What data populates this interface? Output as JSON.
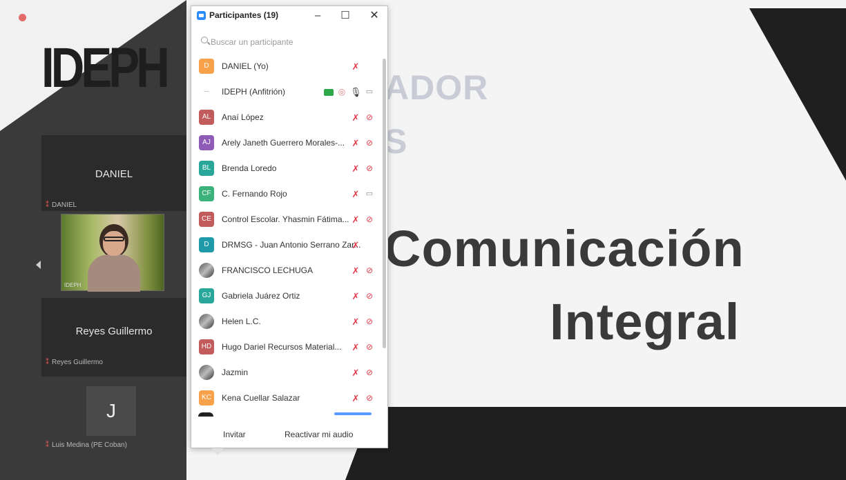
{
  "colors": {
    "accent": "#2d8cff",
    "muted_red": "#e5394a",
    "green_badge": "#2ea84a"
  },
  "slide": {
    "logo": "IDEPH",
    "faded_line_1": "ADOR",
    "faded_line_2": "S",
    "title_line_1": "Comunicación",
    "title_line_2": "Integral"
  },
  "tiles": {
    "daniel": {
      "name": "DANIEL",
      "sub": "DANIEL"
    },
    "video": {
      "label": "IDEPH"
    },
    "reyes": {
      "name": "Reyes Guillermo",
      "sub": "Reyes Guillermo"
    },
    "j": {
      "initial": "J",
      "sub": "Luis Medina (PE Coban)"
    }
  },
  "panel": {
    "title": "Participantes (19)",
    "search_placeholder": "Buscar un participante",
    "participants": [
      {
        "initials": "D",
        "color": "#f7a24b",
        "name": "DANIEL (Yo)",
        "mic": "muted",
        "cam": "none"
      },
      {
        "initials": "",
        "color": "#ffffff",
        "name": "IDEPH (Anfitrión)",
        "mic": "on",
        "cam": "on",
        "badge": "green",
        "host": true
      },
      {
        "initials": "AL",
        "color": "#c25b5b",
        "name": "Anaí López",
        "mic": "muted",
        "cam": "off"
      },
      {
        "initials": "AJ",
        "color": "#8e5bb7",
        "name": "Arely Janeth Guerrero Morales-...",
        "mic": "muted",
        "cam": "off"
      },
      {
        "initials": "BL",
        "color": "#2aa79b",
        "name": "Brenda Loredo",
        "mic": "muted",
        "cam": "off"
      },
      {
        "initials": "CF",
        "color": "#3ab27a",
        "name": "C. Fernando Rojo",
        "mic": "muted",
        "cam": "on"
      },
      {
        "initials": "CE",
        "color": "#c25b5b",
        "name": "Control Escolar. Yhasmin Fátima...",
        "mic": "muted",
        "cam": "off"
      },
      {
        "initials": "D",
        "color": "#1e9aa8",
        "name": "DRMSG - Juan Antonio Serrano Zar...",
        "mic": "muted",
        "cam": "none"
      },
      {
        "initials": "",
        "color": "#666666",
        "name": "FRANCISCO LECHUGA",
        "mic": "muted",
        "cam": "off",
        "photo": true
      },
      {
        "initials": "GJ",
        "color": "#2aa79b",
        "name": "Gabriela Juárez Ortiz",
        "mic": "muted",
        "cam": "off"
      },
      {
        "initials": "",
        "color": "#666666",
        "name": "Helen L.C.",
        "mic": "muted",
        "cam": "off",
        "photo": true
      },
      {
        "initials": "HD",
        "color": "#c25b5b",
        "name": "Hugo Dariel Recursos Material...",
        "mic": "muted",
        "cam": "off"
      },
      {
        "initials": "",
        "color": "#666666",
        "name": "Jazmin",
        "mic": "muted",
        "cam": "off",
        "photo": true
      },
      {
        "initials": "KC",
        "color": "#f7a24b",
        "name": "Kena Cuellar Salazar",
        "mic": "muted",
        "cam": "off"
      }
    ],
    "footer": {
      "invite": "Invitar",
      "unmute": "Reactivar mi audio"
    }
  }
}
